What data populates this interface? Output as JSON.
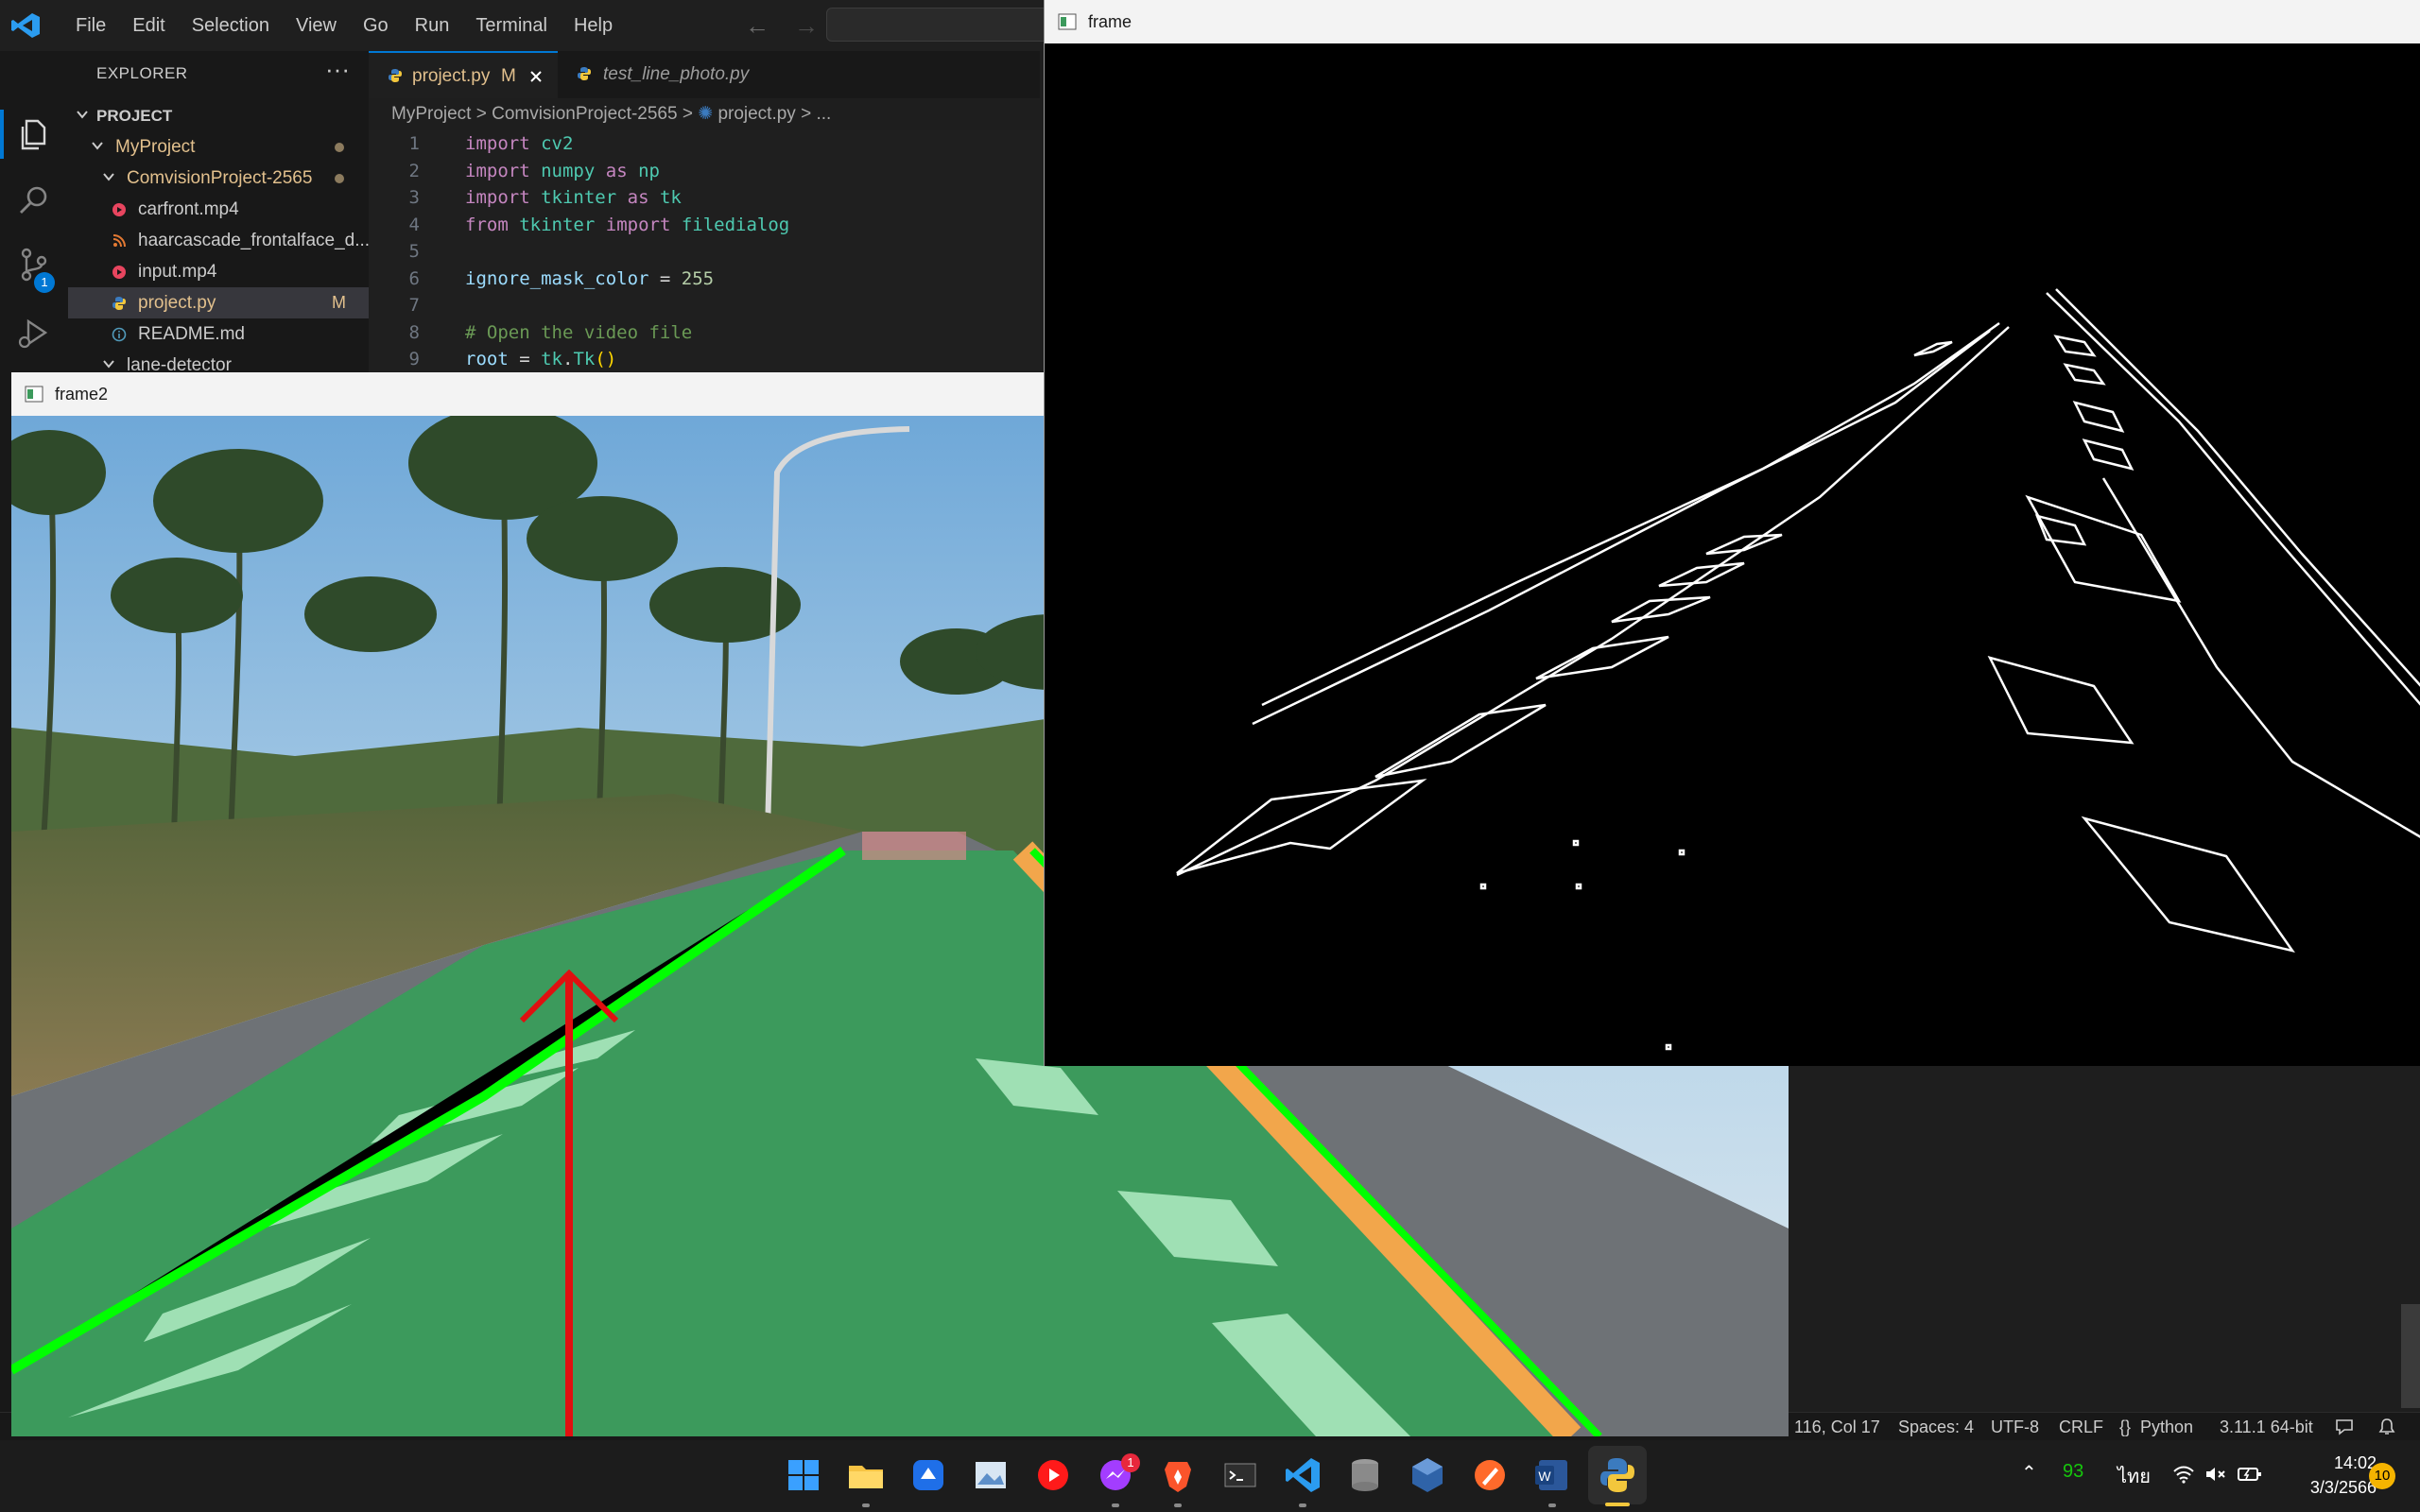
{
  "titlebar": {
    "menu": [
      "File",
      "Edit",
      "Selection",
      "View",
      "Go",
      "Run",
      "Terminal",
      "Help"
    ]
  },
  "activitybar": {
    "icons": [
      "explorer-icon",
      "search-icon",
      "source-control-icon",
      "run-debug-icon",
      "extensions-icon"
    ],
    "scm_badge": "1"
  },
  "sidebar": {
    "title": "EXPLORER",
    "more": "···",
    "root": "PROJECT",
    "tree": [
      {
        "label": "MyProject",
        "type": "folder",
        "color": "#e2c08d"
      },
      {
        "label": "ComvisionProject-2565",
        "type": "folder",
        "color": "#e2c08d"
      },
      {
        "label": "carfront.mp4",
        "type": "video",
        "color": "#cccccc"
      },
      {
        "label": "haarcascade_frontalface_d...",
        "type": "xml",
        "color": "#cccccc"
      },
      {
        "label": "input.mp4",
        "type": "video",
        "color": "#cccccc"
      },
      {
        "label": "project.py",
        "type": "python",
        "color": "#e2c08d",
        "flag": "M"
      },
      {
        "label": "README.md",
        "type": "info",
        "color": "#cccccc"
      },
      {
        "label": "lane-detector",
        "type": "folder",
        "color": "#cccccc"
      }
    ]
  },
  "tabs": [
    {
      "label": "project.py",
      "flag": "M",
      "active": true
    },
    {
      "label": "test_line_photo.py",
      "active": false
    }
  ],
  "breadcrumbs": {
    "items": [
      "MyProject",
      "ComvisionProject-2565",
      "project.py",
      "..."
    ],
    "sep": ">"
  },
  "code": [
    {
      "n": "1",
      "tokens": [
        [
          "kw",
          "import"
        ],
        [
          "op",
          " "
        ],
        [
          "mod",
          "cv2"
        ]
      ]
    },
    {
      "n": "2",
      "tokens": [
        [
          "kw",
          "import"
        ],
        [
          "op",
          " "
        ],
        [
          "mod",
          "numpy"
        ],
        [
          "op",
          " "
        ],
        [
          "kw",
          "as"
        ],
        [
          "op",
          " "
        ],
        [
          "mod",
          "np"
        ]
      ]
    },
    {
      "n": "3",
      "tokens": [
        [
          "kw",
          "import"
        ],
        [
          "op",
          " "
        ],
        [
          "mod",
          "tkinter"
        ],
        [
          "op",
          " "
        ],
        [
          "kw",
          "as"
        ],
        [
          "op",
          " "
        ],
        [
          "mod",
          "tk"
        ]
      ]
    },
    {
      "n": "4",
      "tokens": [
        [
          "kw",
          "from"
        ],
        [
          "op",
          " "
        ],
        [
          "mod",
          "tkinter"
        ],
        [
          "op",
          " "
        ],
        [
          "kw",
          "import"
        ],
        [
          "op",
          " "
        ],
        [
          "mod",
          "filedialog"
        ]
      ]
    },
    {
      "n": "5",
      "tokens": []
    },
    {
      "n": "6",
      "tokens": [
        [
          "var",
          "ignore_mask_color"
        ],
        [
          "op",
          " = "
        ],
        [
          "num",
          "255"
        ]
      ]
    },
    {
      "n": "7",
      "tokens": []
    },
    {
      "n": "8",
      "tokens": [
        [
          "cmt",
          "# Open the video file"
        ]
      ]
    },
    {
      "n": "9",
      "tokens": [
        [
          "var",
          "root"
        ],
        [
          "op",
          " = "
        ],
        [
          "mod",
          "tk"
        ],
        [
          "op",
          "."
        ],
        [
          "mod",
          "Tk"
        ],
        [
          "paren",
          "()"
        ]
      ]
    }
  ],
  "windows": {
    "frame2_title": "frame2",
    "frame_title": "frame"
  },
  "statusbar": {
    "position": "116, Col 17",
    "spaces": "Spaces: 4",
    "encoding": "UTF-8",
    "eol": "CRLF",
    "language": "Python",
    "interpreter": "3.11.1 64-bit"
  },
  "taskbar": {
    "apps": [
      "start-icon",
      "file-explorer-icon",
      "app-blue-icon",
      "photos-icon",
      "youtube-music-icon",
      "messenger-icon",
      "brave-icon",
      "terminal-icon",
      "vscode-icon",
      "database-icon",
      "virtualbox-icon",
      "pen-app-icon",
      "word-icon",
      "python-icon"
    ],
    "messenger_badge": "1",
    "tray": {
      "battery_percent": "93",
      "language": "ไทย",
      "time": "14:02",
      "date": "3/3/2566",
      "notifications": "10"
    }
  },
  "colors": {
    "accent": "#0078d4",
    "lane_green": "#00ff00",
    "arrow_red": "#e01010",
    "lane_fill": "#3c9a5c"
  }
}
